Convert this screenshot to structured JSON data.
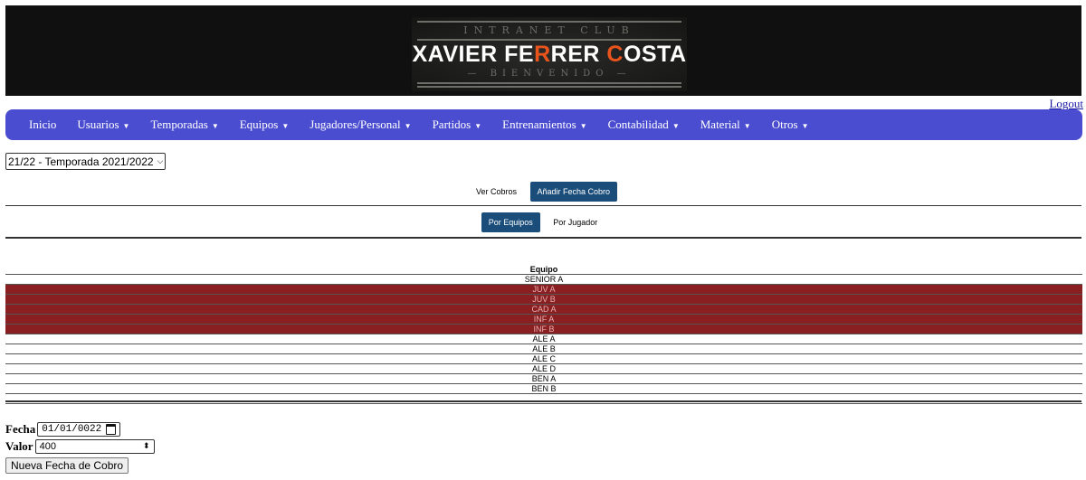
{
  "banner": {
    "top_text": "INTRANET CLUB",
    "name_part1": "XAVIER FE",
    "name_accent1": "R",
    "name_part2": "RER ",
    "name_accent2": "C",
    "name_part3": "OSTA",
    "bottom_text": "— BIENVENIDO —",
    "accent_color": "#e8541c"
  },
  "logout_label": "Logout",
  "nav": {
    "items": [
      {
        "label": "Inicio",
        "caret": ""
      },
      {
        "label": "Usuarios",
        "caret": "▼"
      },
      {
        "label": "Temporadas",
        "caret": "▼"
      },
      {
        "label": "Equipos",
        "caret": "▼"
      },
      {
        "label": "Jugadores/Personal",
        "caret": "▼"
      },
      {
        "label": "Partidos",
        "caret": "▼"
      },
      {
        "label": "Entrenamientos",
        "caret": "▼"
      },
      {
        "label": "Contabilidad",
        "caret": "▼"
      },
      {
        "label": "Material",
        "caret": "▼"
      },
      {
        "label": "Otros",
        "caret": "▼"
      }
    ],
    "color": "#4b4dd1"
  },
  "season_select": {
    "value": "21/22 - Temporada 2021/2022"
  },
  "view_tabs": {
    "ver_cobros": "Ver Cobros",
    "anadir": "Añadir Fecha Cobro"
  },
  "group_tabs": {
    "por_equipos": "Por Equipos",
    "por_jugador": "Por Jugador"
  },
  "table": {
    "header": "Equipo",
    "rows": [
      {
        "team": "SENIOR A",
        "unpaid": false
      },
      {
        "team": "JUV A",
        "unpaid": true
      },
      {
        "team": "JUV B",
        "unpaid": true
      },
      {
        "team": "CAD A",
        "unpaid": true
      },
      {
        "team": "INF A",
        "unpaid": true
      },
      {
        "team": "INF B",
        "unpaid": true
      },
      {
        "team": "ALE A",
        "unpaid": false
      },
      {
        "team": "ALE B",
        "unpaid": false
      },
      {
        "team": "ALE C",
        "unpaid": false
      },
      {
        "team": "ALE D",
        "unpaid": false
      },
      {
        "team": "BEN A",
        "unpaid": false
      },
      {
        "team": "BEN B",
        "unpaid": false
      },
      {
        "team": "",
        "unpaid": false
      }
    ],
    "unpaid_color": "#8a1f22"
  },
  "form": {
    "fecha_label": "Fecha",
    "fecha_value": "01/01/0022",
    "valor_label": "Valor",
    "valor_value": "400",
    "submit_label": "Nueva Fecha de Cobro"
  }
}
